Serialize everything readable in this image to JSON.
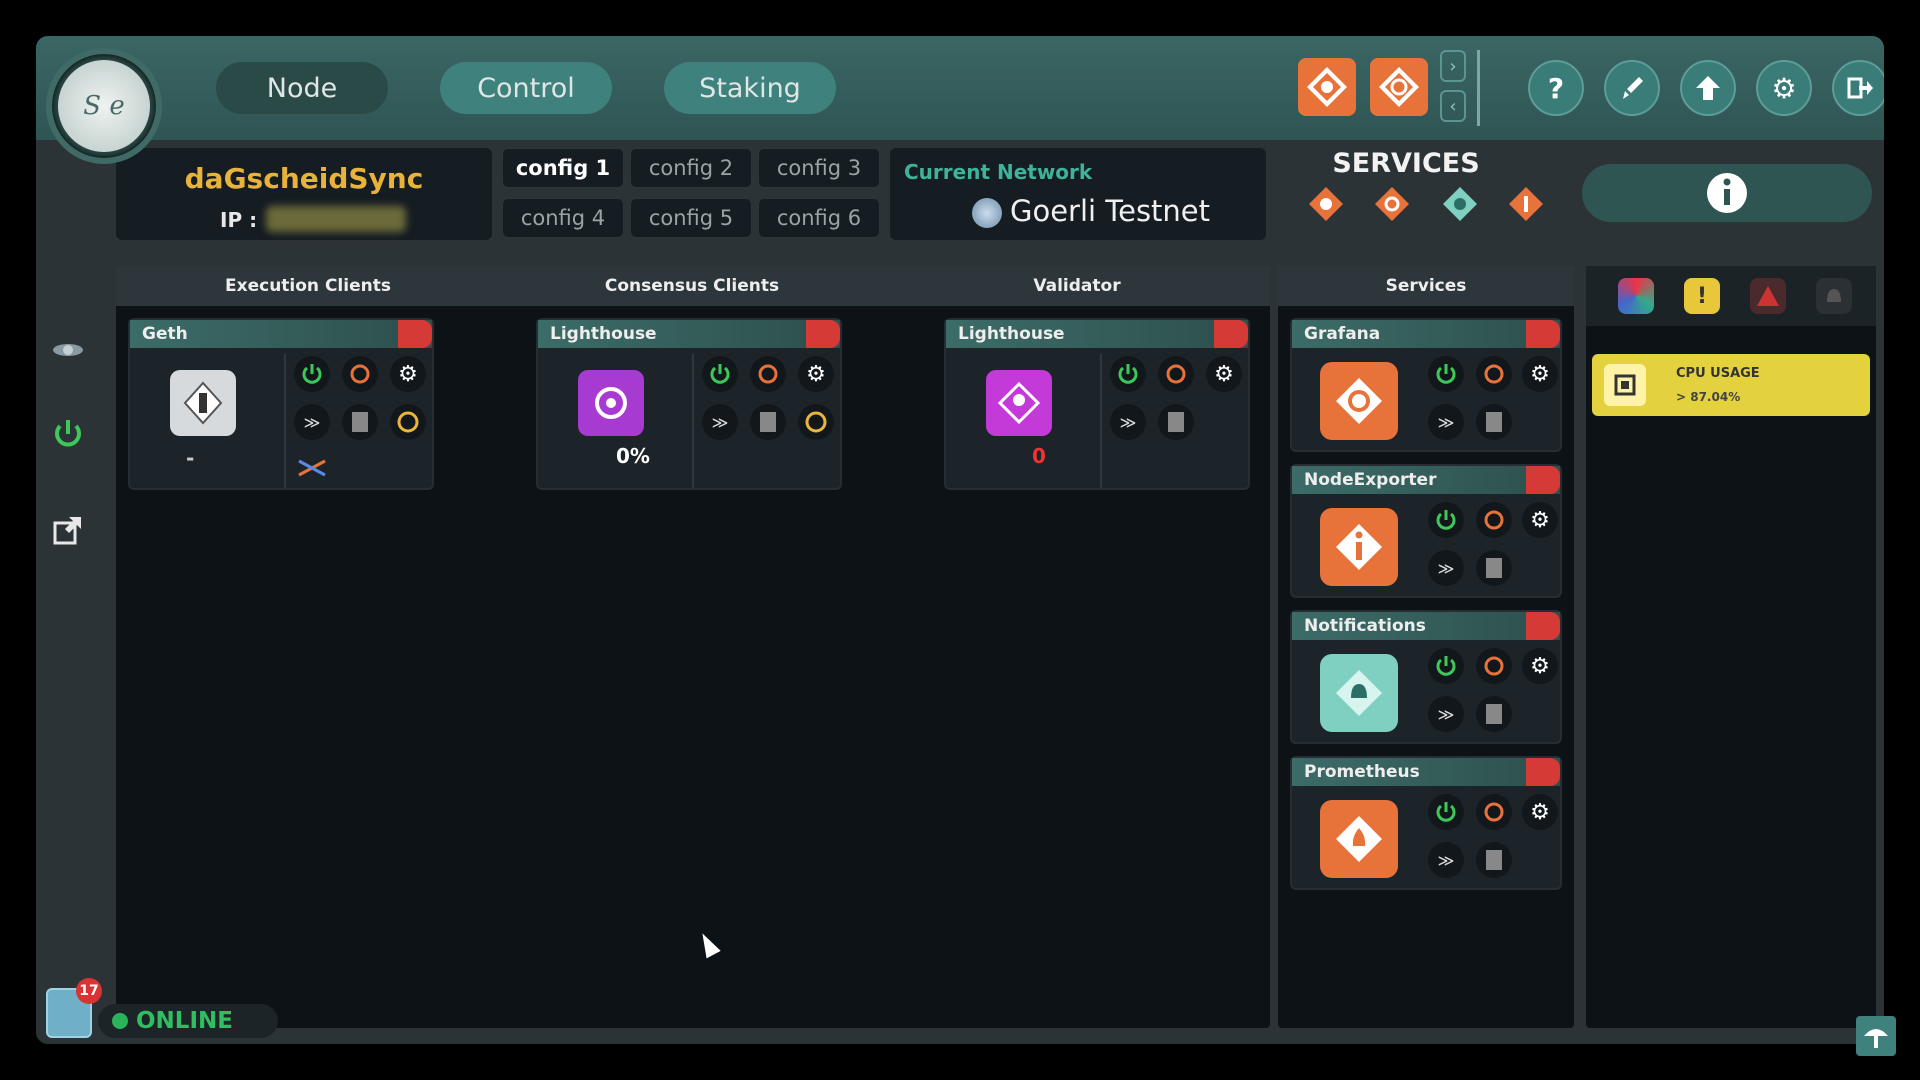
{
  "header": {
    "nav": [
      "Node",
      "Control",
      "Staking"
    ],
    "logo_text": "S e"
  },
  "node": {
    "name": "daGscheidSync",
    "ip_label": "IP :"
  },
  "configs": [
    "config 1",
    "config 2",
    "config 3",
    "config 4",
    "config 5",
    "config 6"
  ],
  "network": {
    "label": "Current Network",
    "name": "Goerli Testnet"
  },
  "services_title": "SERVICES",
  "columns": {
    "execution": "Execution Clients",
    "consensus": "Consensus Clients",
    "validator": "Validator",
    "services": "Services"
  },
  "clients": {
    "geth": {
      "name": "Geth",
      "status": "-"
    },
    "lighthouse_cc": {
      "name": "Lighthouse",
      "sync": "0%"
    },
    "lighthouse_vc": {
      "name": "Lighthouse",
      "keys": "0"
    }
  },
  "services": [
    "Grafana",
    "NodeExporter",
    "Notifications",
    "Prometheus"
  ],
  "alert": {
    "title": "CPU USAGE",
    "value": "> 87.04%"
  },
  "status": {
    "online": "ONLINE",
    "notifications": "17"
  },
  "colors": {
    "accent": "#3f817d",
    "orange": "#e8733a",
    "red": "#d63a36",
    "green": "#29b35a",
    "yellow": "#e4d13e"
  }
}
